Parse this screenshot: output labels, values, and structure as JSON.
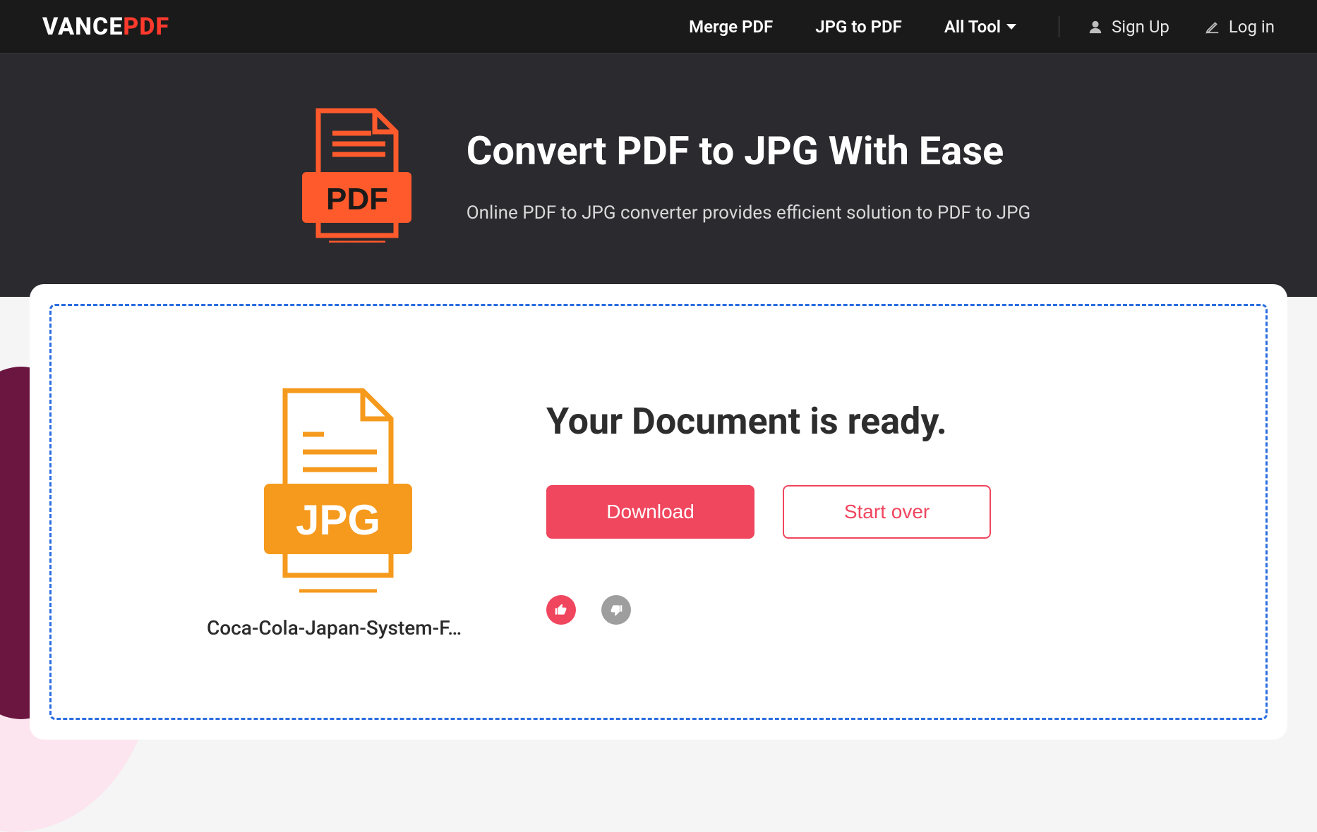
{
  "header": {
    "logo_vance": "VANCE",
    "logo_pdf": "PDF",
    "nav": [
      {
        "label": "Merge PDF"
      },
      {
        "label": "JPG to PDF"
      },
      {
        "label": "All Tool"
      }
    ],
    "signup": "Sign Up",
    "login": "Log in"
  },
  "hero": {
    "title": "Convert PDF to JPG With Ease",
    "subtitle": "Online PDF to JPG converter provides efficient solution to PDF to JPG",
    "icon_label": "PDF"
  },
  "result": {
    "file_icon_label": "JPG",
    "file_name": "Coca-Cola-Japan-System-F…",
    "ready_text": "Your Document is ready.",
    "download_label": "Download",
    "startover_label": "Start over"
  }
}
